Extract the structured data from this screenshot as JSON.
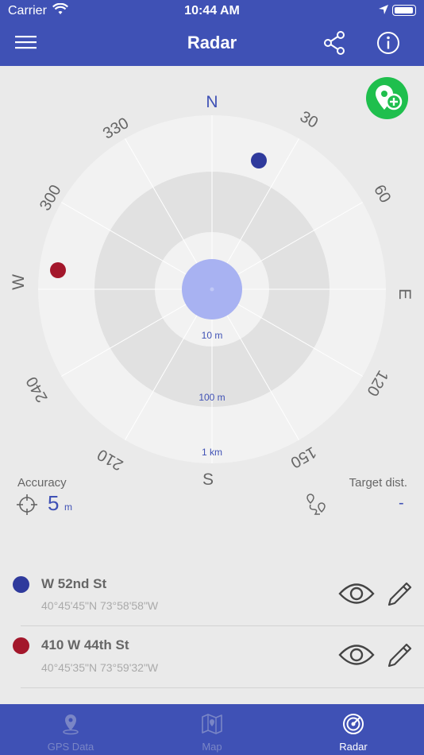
{
  "status_bar": {
    "carrier": "Carrier",
    "time": "10:44 AM"
  },
  "nav": {
    "title": "Radar"
  },
  "radar": {
    "north_label": "N",
    "east_label": "E",
    "south_label": "S",
    "west_label": "W",
    "bearing_labels": [
      "30",
      "60",
      "120",
      "150",
      "210",
      "240",
      "300",
      "330"
    ],
    "ring_labels": [
      "10 m",
      "100 m",
      "1 km"
    ],
    "accent_color": "#3f51b5"
  },
  "accuracy": {
    "label": "Accuracy",
    "value": "5",
    "unit": "m"
  },
  "target": {
    "label": "Target dist.",
    "value": "-"
  },
  "places": [
    {
      "name": "W 52nd St",
      "coords": "40°45'45\"N 73°58'58\"W",
      "color": "#2f3a9c"
    },
    {
      "name": "410 W 44th St",
      "coords": "40°45'35\"N 73°59'32\"W",
      "color": "#a3172b"
    }
  ],
  "tabs": [
    {
      "label": "GPS Data",
      "icon": "map-pin-icon"
    },
    {
      "label": "Map",
      "icon": "map-icon"
    },
    {
      "label": "Radar",
      "icon": "radar-icon"
    }
  ]
}
